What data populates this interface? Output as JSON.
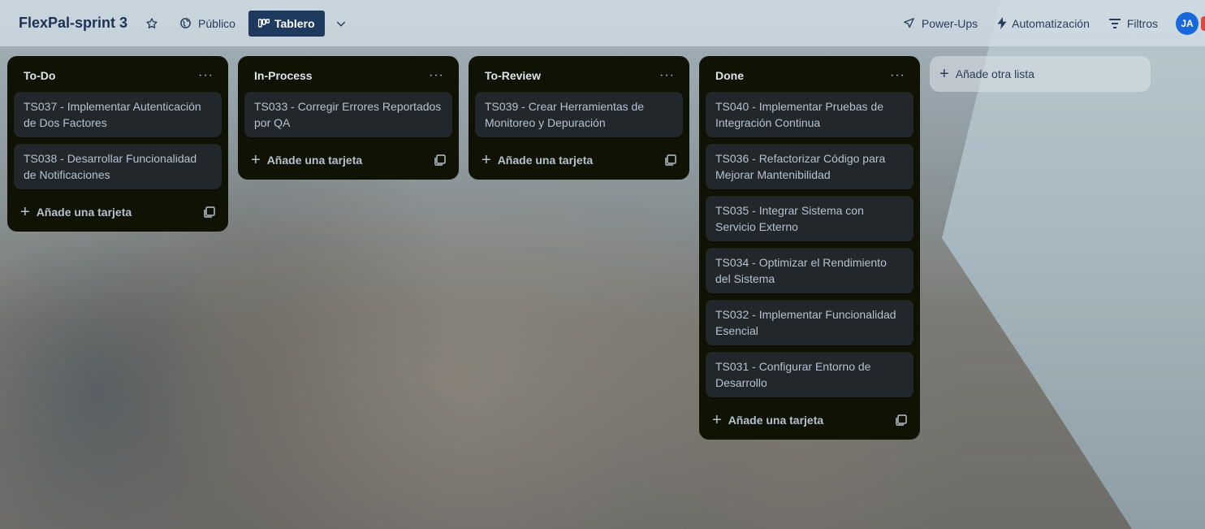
{
  "header": {
    "board_title": "FlexPal-sprint 3",
    "visibility_label": "Público",
    "view_label": "Tablero",
    "powerups_label": "Power-Ups",
    "automation_label": "Automatización",
    "filters_label": "Filtros",
    "avatar_initials": "JA"
  },
  "lists": [
    {
      "title": "To-Do",
      "cards": [
        "TS037 - Implementar Autenticación de Dos Factores",
        "TS038 - Desarrollar Funcionalidad de Notificaciones"
      ],
      "add_card_label": "Añade una tarjeta"
    },
    {
      "title": "In-Process",
      "cards": [
        "TS033 - Corregir Errores Reportados por QA"
      ],
      "add_card_label": "Añade una tarjeta"
    },
    {
      "title": "To-Review",
      "cards": [
        "TS039 - Crear Herramientas de Monitoreo y Depuración"
      ],
      "add_card_label": "Añade una tarjeta"
    },
    {
      "title": "Done",
      "cards": [
        "TS040 - Implementar Pruebas de Integración Continua",
        "TS036 - Refactorizar Código para Mejorar Mantenibilidad",
        "TS035 - Integrar Sistema con Servicio Externo",
        "TS034 - Optimizar el Rendimiento del Sistema",
        "TS032 - Implementar Funcionalidad Esencial",
        "TS031 - Configurar Entorno de Desarrollo"
      ],
      "add_card_label": "Añade una tarjeta"
    }
  ],
  "add_list_label": "Añade otra lista",
  "icons": {
    "menu": "more-dots-icon",
    "template": "card-template-icon",
    "plus": "plus-icon"
  }
}
